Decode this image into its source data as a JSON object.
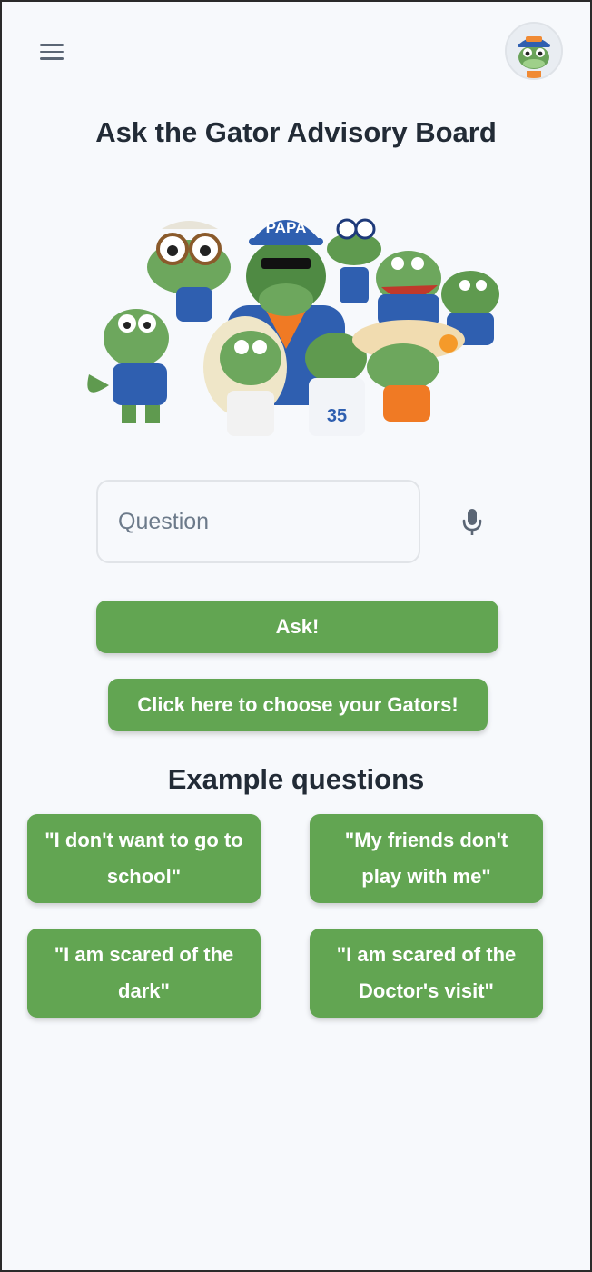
{
  "header": {
    "menu_icon": "hamburger-menu-icon",
    "avatar_icon": "gator-avatar-icon"
  },
  "main": {
    "title": "Ask the Gator Advisory Board",
    "hero_image": "gator-family-illustration",
    "question_input": {
      "placeholder": "Question",
      "value": ""
    },
    "mic_icon": "microphone-icon",
    "ask_label": "Ask!",
    "choose_label": "Click here to choose your Gators!"
  },
  "examples": {
    "title": "Example questions",
    "items": [
      {
        "label": "\"I don't want to go to school\""
      },
      {
        "label": "\"My friends don't play with me\""
      },
      {
        "label": "\"I am scared of the dark\""
      },
      {
        "label": "\"I am scared of the Doctor's visit\""
      }
    ]
  },
  "colors": {
    "accent_green": "#62a552",
    "background": "#f7f9fc",
    "title_text": "#222b36",
    "gator_green": "#5f9a4f",
    "florida_blue": "#1f4fa8",
    "florida_orange": "#f07a24"
  }
}
